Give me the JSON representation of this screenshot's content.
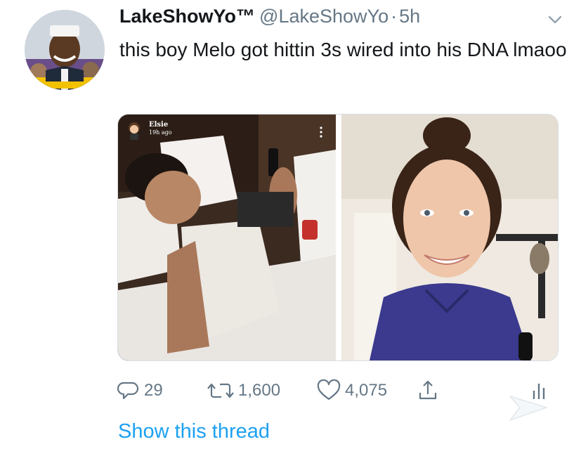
{
  "tweet": {
    "display_name": "LakeShowYo™",
    "handle": "@LakeShowYo",
    "separator": "·",
    "time": "5h",
    "text": "this boy Melo got hittin 3s wired into his DNA lmaoo"
  },
  "media": {
    "snap_name": "Elsie",
    "snap_time": "19h ago"
  },
  "actions": {
    "replies": "29",
    "retweets": "1,600",
    "likes": "4,075"
  },
  "thread_link": "Show this thread",
  "colors": {
    "link": "#1da1f2",
    "muted": "#657786",
    "text": "#14171a"
  },
  "icons": {
    "reply": "reply-icon",
    "retweet": "retweet-icon",
    "like": "heart-icon",
    "share": "share-icon",
    "analytics": "analytics-icon",
    "caret": "chevron-down-icon"
  }
}
